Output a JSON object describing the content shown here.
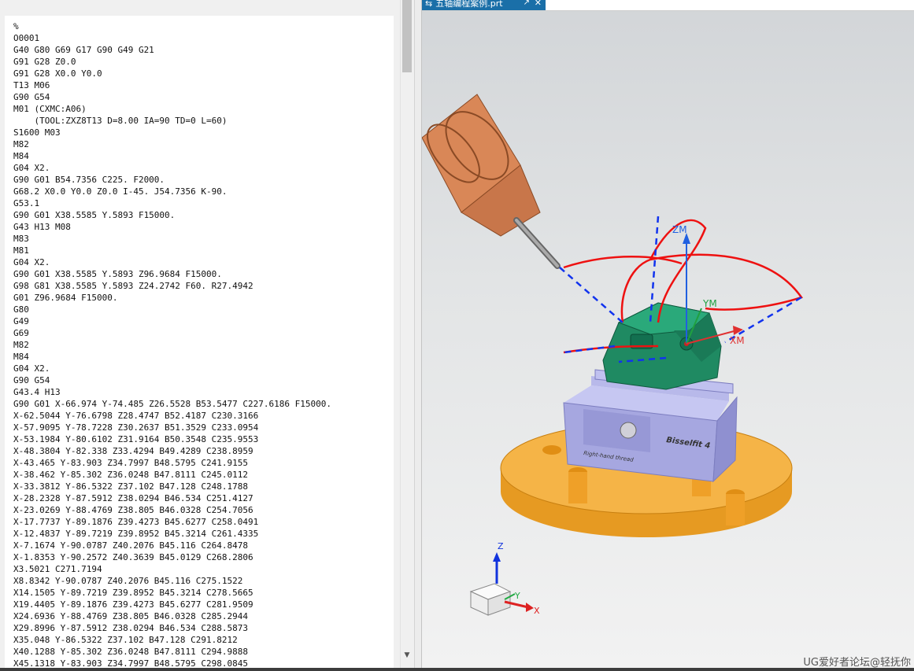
{
  "window": {
    "tab_title": "五轴编程案例.prt",
    "tab_icon": "part-file-icon",
    "close_glyph": "✕",
    "popout_glyph": "↗"
  },
  "gcode": {
    "lines": [
      "%",
      "O0001",
      "G40 G80 G69 G17 G90 G49 G21",
      "G91 G28 Z0.0",
      "G91 G28 X0.0 Y0.0",
      "T13 M06",
      "G90 G54",
      "M01 (CXMC:A06)",
      "    (TOOL:ZXZ8T13 D=8.00 IA=90 TD=0 L=60)",
      "S1600 M03",
      "M82",
      "M84",
      "G04 X2.",
      "G90 G01 B54.7356 C225. F2000.",
      "G68.2 X0.0 Y0.0 Z0.0 I-45. J54.7356 K-90.",
      "G53.1",
      "G90 G01 X38.5585 Y.5893 F15000.",
      "G43 H13 M08",
      "M83",
      "M81",
      "G04 X2.",
      "G90 G01 X38.5585 Y.5893 Z96.9684 F15000.",
      "G98 G81 X38.5585 Y.5893 Z24.2742 F60. R27.4942",
      "G01 Z96.9684 F15000.",
      "G80",
      "G49",
      "G69",
      "M82",
      "M84",
      "G04 X2.",
      "G90 G54",
      "G43.4 H13",
      "G90 G01 X-66.974 Y-74.485 Z26.5528 B53.5477 C227.6186 F15000.",
      "X-62.5044 Y-76.6798 Z28.4747 B52.4187 C230.3166",
      "X-57.9095 Y-78.7228 Z30.2637 B51.3529 C233.0954",
      "X-53.1984 Y-80.6102 Z31.9164 B50.3548 C235.9553",
      "X-48.3804 Y-82.338 Z33.4294 B49.4289 C238.8959",
      "X-43.465 Y-83.903 Z34.7997 B48.5795 C241.9155",
      "X-38.462 Y-85.302 Z36.0248 B47.8111 C245.0112",
      "X-33.3812 Y-86.5322 Z37.102 B47.128 C248.1788",
      "X-28.2328 Y-87.5912 Z38.0294 B46.534 C251.4127",
      "X-23.0269 Y-88.4769 Z38.805 B46.0328 C254.7056",
      "X-17.7737 Y-89.1876 Z39.4273 B45.6277 C258.0491",
      "X-12.4837 Y-89.7219 Z39.8952 B45.3214 C261.4335",
      "X-7.1674 Y-90.0787 Z40.2076 B45.116 C264.8478",
      "X-1.8353 Y-90.2572 Z40.3639 B45.0129 C268.2806",
      "X3.5021 C271.7194",
      "X8.8342 Y-90.0787 Z40.2076 B45.116 C275.1522",
      "X14.1505 Y-89.7219 Z39.8952 B45.3214 C278.5665",
      "X19.4405 Y-89.1876 Z39.4273 B45.6277 C281.9509",
      "X24.6936 Y-88.4769 Z38.805 B46.0328 C285.2944",
      "X29.8996 Y-87.5912 Z38.0294 B46.534 C288.5873",
      "X35.048 Y-86.5322 Z37.102 B47.128 C291.8212",
      "X40.1288 Y-85.302 Z36.0248 B47.8111 C294.9888",
      "X45.1318 Y-83.903 Z34.7997 B48.5795 C298.0845"
    ]
  },
  "viewport": {
    "csys_labels": {
      "zm": "ZM",
      "ym": "YM",
      "xm": "XM"
    },
    "triad_labels": {
      "z": "Z",
      "y": "Y",
      "x": "X"
    },
    "vise_brand": "Bisselfit 4",
    "vise_text": "Right-hand thread",
    "watermark": "UG爱好者论坛@轻抚你",
    "colors": {
      "toolpath_red": "#ee1111",
      "rapid_blue": "#1133ee",
      "part_green": "#1f8a62",
      "vise_lavender": "#a6a7e0",
      "base_orange": "#f0a532",
      "holder_copper": "#d98757",
      "tab_blue": "#1a6fa8"
    }
  }
}
